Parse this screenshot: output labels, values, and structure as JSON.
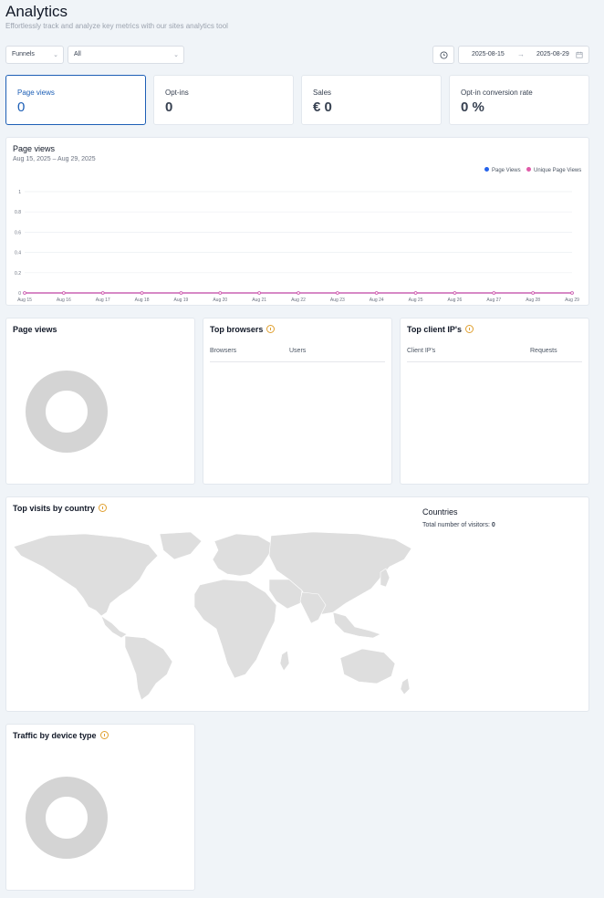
{
  "page": {
    "title": "Analytics",
    "subtitle": "Effortlessly track and analyze key metrics with our sites analytics tool"
  },
  "filters": {
    "type_select": "Funnels",
    "scope_select": "All",
    "date_from": "2025-08-15",
    "date_to": "2025-08-29"
  },
  "kpis": [
    {
      "label": "Page views",
      "value": "0"
    },
    {
      "label": "Opt-ins",
      "value": "0"
    },
    {
      "label": "Sales",
      "value": "€ 0"
    },
    {
      "label": "Opt-in conversion rate",
      "value": "0 %"
    }
  ],
  "pageviews_chart": {
    "title": "Page views",
    "subtitle": "Aug 15, 2025 – Aug 29, 2025",
    "legend": [
      {
        "name": "Page Views",
        "color": "#2563eb"
      },
      {
        "name": "Unique Page Views",
        "color": "#e05aa8"
      }
    ]
  },
  "chart_data": {
    "type": "line",
    "title": "Page views",
    "subtitle": "Aug 15, 2025 – Aug 29, 2025",
    "x": [
      "Aug 15",
      "Aug 16",
      "Aug 17",
      "Aug 18",
      "Aug 19",
      "Aug 20",
      "Aug 21",
      "Aug 22",
      "Aug 23",
      "Aug 24",
      "Aug 25",
      "Aug 26",
      "Aug 27",
      "Aug 28",
      "Aug 29"
    ],
    "yticks": [
      "0",
      "0.2",
      "0.4",
      "0.6",
      "0.8",
      "1"
    ],
    "ylim": [
      0,
      1
    ],
    "grid": true,
    "legend_position": "top-right",
    "series": [
      {
        "name": "Page Views",
        "color": "#2563eb",
        "values": [
          0,
          0,
          0,
          0,
          0,
          0,
          0,
          0,
          0,
          0,
          0,
          0,
          0,
          0,
          0
        ]
      },
      {
        "name": "Unique Page Views",
        "color": "#e05aa8",
        "values": [
          0,
          0,
          0,
          0,
          0,
          0,
          0,
          0,
          0,
          0,
          0,
          0,
          0,
          0,
          0
        ]
      }
    ]
  },
  "pageviews_donut": {
    "title": "Page views"
  },
  "browsers": {
    "title": "Top browsers",
    "columns": [
      "Browsers",
      "Users"
    ]
  },
  "client_ips": {
    "title": "Top client IP's",
    "columns": [
      "Client IP's",
      "Requests"
    ]
  },
  "countries": {
    "title": "Top visits by country",
    "panel_title": "Countries",
    "total_label": "Total number of visitors:",
    "total_value": "0"
  },
  "device": {
    "title": "Traffic by device type"
  },
  "colors": {
    "accent": "#1d5fb6",
    "donut": "#d4d4d4",
    "map": "#dedede",
    "info_icon": "#e0a030"
  }
}
